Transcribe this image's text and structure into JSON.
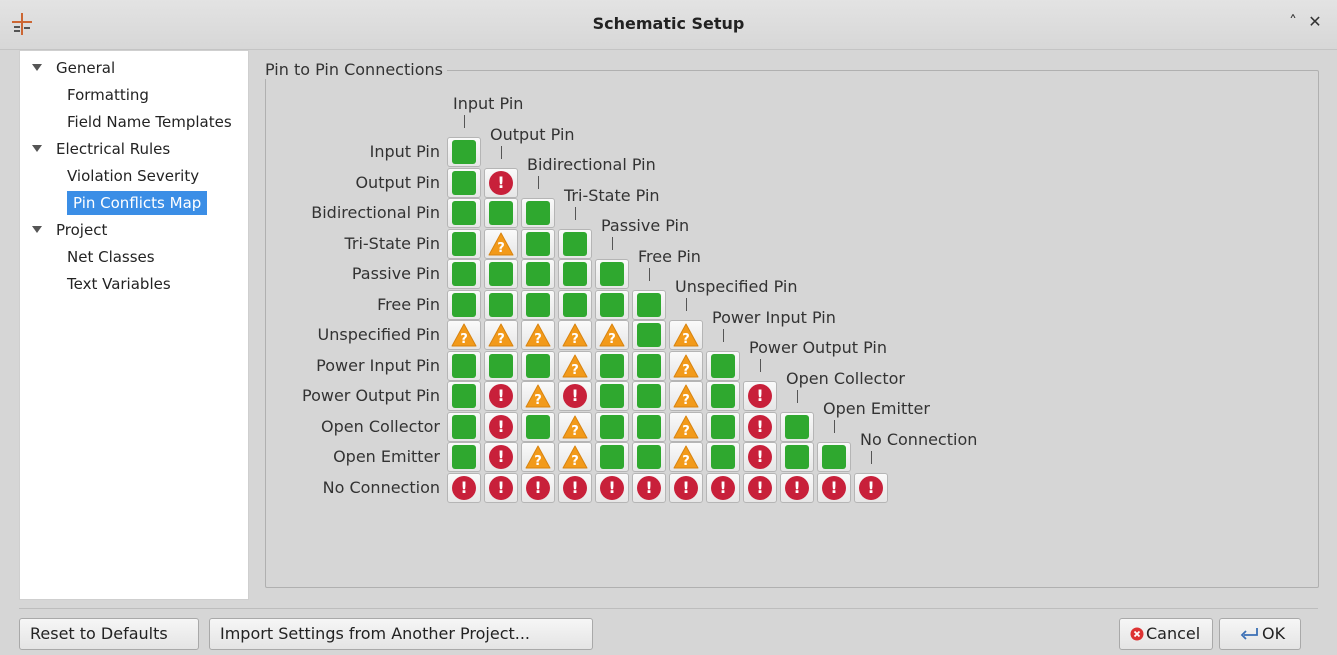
{
  "window": {
    "title": "Schematic Setup"
  },
  "sidebar": {
    "items": [
      {
        "label": "General",
        "level": 0,
        "expandable": true,
        "selected": false
      },
      {
        "label": "Formatting",
        "level": 1,
        "selected": false
      },
      {
        "label": "Field Name Templates",
        "level": 1,
        "selected": false
      },
      {
        "label": "Electrical Rules",
        "level": 0,
        "expandable": true,
        "selected": false
      },
      {
        "label": "Violation Severity",
        "level": 1,
        "selected": false
      },
      {
        "label": "Pin Conflicts Map",
        "level": 1,
        "selected": true
      },
      {
        "label": "Project",
        "level": 0,
        "expandable": true,
        "selected": false
      },
      {
        "label": "Net Classes",
        "level": 1,
        "selected": false
      },
      {
        "label": "Text Variables",
        "level": 1,
        "selected": false
      }
    ]
  },
  "panel": {
    "title": "Pin to Pin Connections"
  },
  "matrix": {
    "pin_types": [
      "Input Pin",
      "Output Pin",
      "Bidirectional Pin",
      "Tri-State Pin",
      "Passive Pin",
      "Free Pin",
      "Unspecified Pin",
      "Power Input Pin",
      "Power Output Pin",
      "Open Collector",
      "Open Emitter",
      "No Connection"
    ],
    "cells": [
      [
        "ok"
      ],
      [
        "ok",
        "err"
      ],
      [
        "ok",
        "ok",
        "ok"
      ],
      [
        "ok",
        "warn",
        "ok",
        "ok"
      ],
      [
        "ok",
        "ok",
        "ok",
        "ok",
        "ok"
      ],
      [
        "ok",
        "ok",
        "ok",
        "ok",
        "ok",
        "ok"
      ],
      [
        "warn",
        "warn",
        "warn",
        "warn",
        "warn",
        "ok",
        "warn"
      ],
      [
        "ok",
        "ok",
        "ok",
        "warn",
        "ok",
        "ok",
        "warn",
        "ok"
      ],
      [
        "ok",
        "err",
        "warn",
        "err",
        "ok",
        "ok",
        "warn",
        "ok",
        "err"
      ],
      [
        "ok",
        "err",
        "ok",
        "warn",
        "ok",
        "ok",
        "warn",
        "ok",
        "err",
        "ok"
      ],
      [
        "ok",
        "err",
        "warn",
        "warn",
        "ok",
        "ok",
        "warn",
        "ok",
        "err",
        "ok",
        "ok"
      ],
      [
        "err",
        "err",
        "err",
        "err",
        "err",
        "err",
        "err",
        "err",
        "err",
        "err",
        "err",
        "err"
      ]
    ],
    "legend_symbols": {
      "ok": "ok-square-icon",
      "warn": "warning-icon",
      "err": "error-icon"
    },
    "colors": {
      "ok": "#2fa82f",
      "warn": "#f29a1a",
      "err": "#c8203a"
    }
  },
  "buttons": {
    "reset": "Reset to Defaults",
    "import": "Import Settings from Another Project...",
    "cancel": "Cancel",
    "ok": "OK"
  }
}
